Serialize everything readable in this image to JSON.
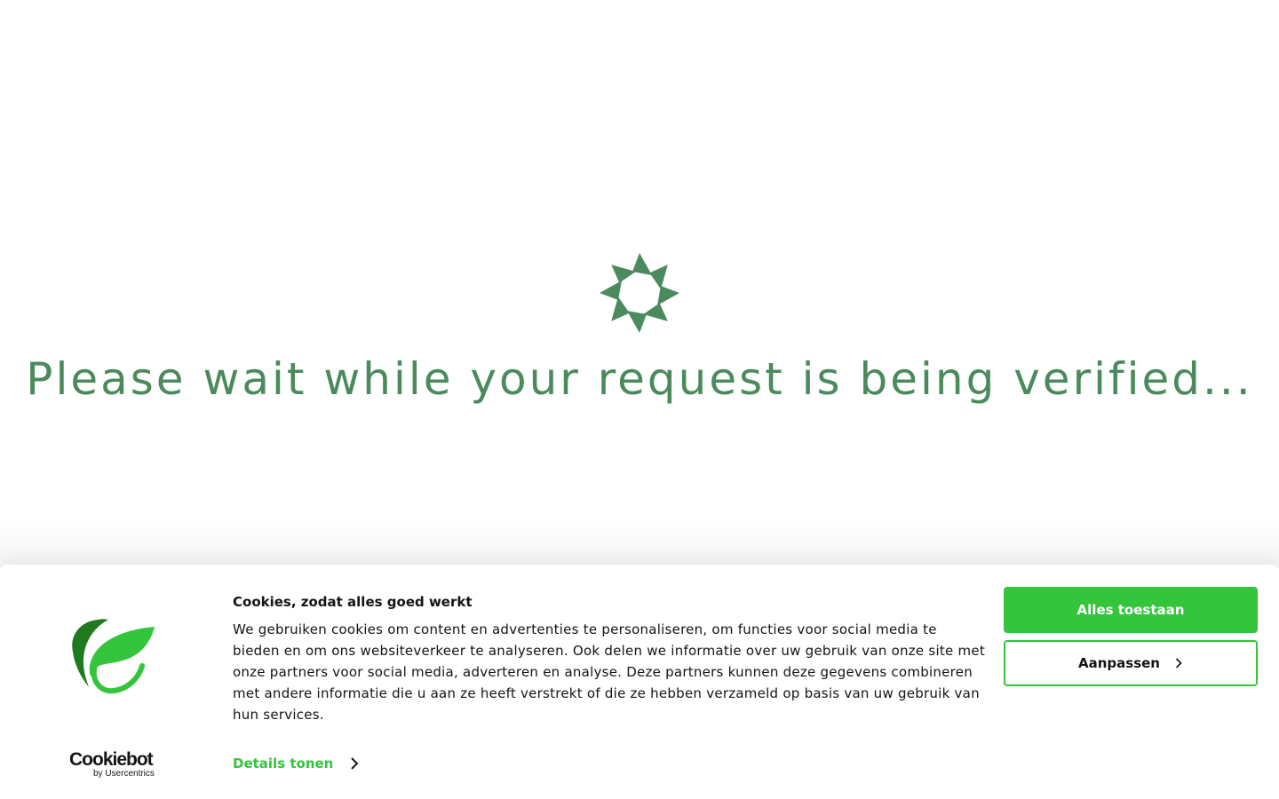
{
  "verification": {
    "message": "Please wait while your request is being verified...",
    "spinner_icon": "spinner-icon",
    "accent_color": "#4a8a5c"
  },
  "cookie_banner": {
    "title": "Cookies, zodat alles goed werkt",
    "body": "We gebruiken cookies om content en advertenties te personaliseren, om functies voor social media te bieden en om ons websiteverkeer te analyseren. Ook delen we informatie over uw gebruik van onze site met onze partners voor social media, adverteren en analyse. Deze partners kunnen deze gegevens combineren met andere informatie die u aan ze heeft verstrekt of die ze hebben verzameld op basis van uw gebruik van hun services.",
    "details_label": "Details tonen",
    "allow_all_label": "Alles toestaan",
    "customize_label": "Aanpassen",
    "brand_logo_icon": "leaf-logo-icon",
    "cookiebot_wordmark": "Cookiebot",
    "cookiebot_byline": "by Usercentrics",
    "accent_color": "#34c53c"
  }
}
